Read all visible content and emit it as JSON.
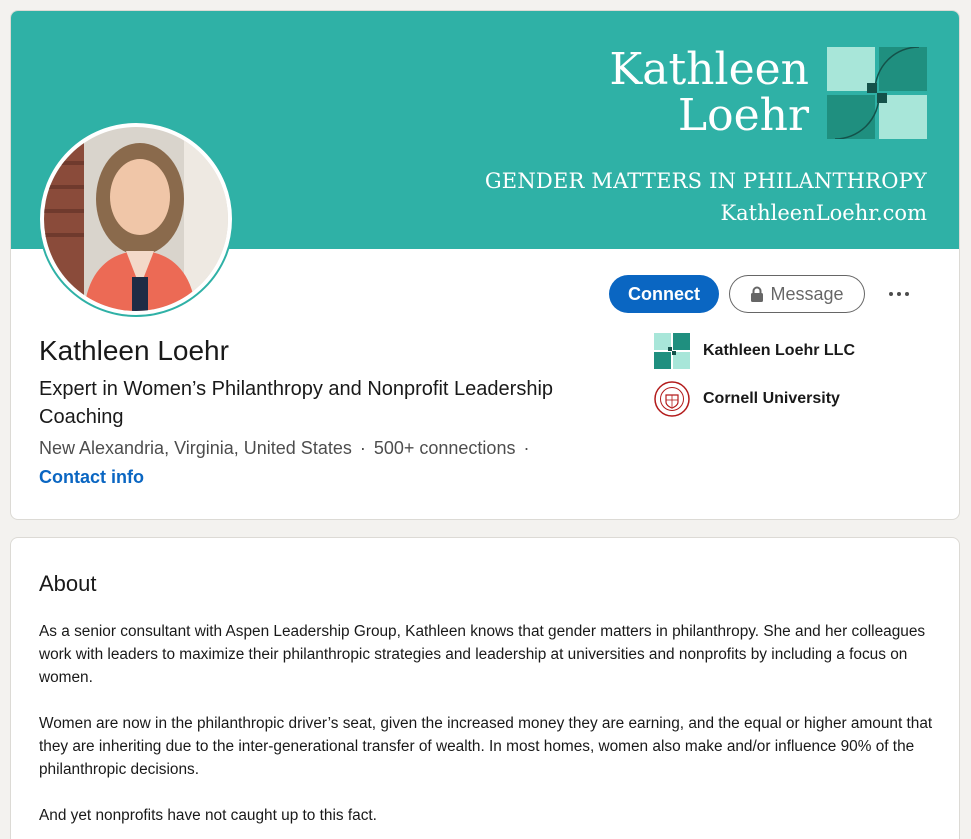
{
  "banner": {
    "name_line1": "Kathleen",
    "name_line2": "Loehr",
    "tagline": "GENDER MATTERS IN PHILANTHROPY",
    "url": "KathleenLoehr.com",
    "color": "#2fb1a6"
  },
  "profile": {
    "name": "Kathleen Loehr",
    "headline": "Expert in Women’s Philanthropy and Nonprofit Leadership Coaching",
    "location": "New Alexandria, Virginia, United States",
    "sep": "·",
    "connections": "500+ connections",
    "contact_info": "Contact info"
  },
  "actions": {
    "connect_label": "Connect",
    "message_label": "Message",
    "connect_color": "#0a66c2"
  },
  "orgs": [
    {
      "name": "Kathleen Loehr LLC",
      "icon": "company-logo-icon"
    },
    {
      "name": "Cornell University",
      "icon": "university-seal-icon"
    }
  ],
  "about": {
    "title": "About",
    "paragraphs": [
      "As a senior consultant with Aspen Leadership Group, Kathleen knows that gender matters in philanthropy. She and her colleagues work with leaders to maximize their philanthropic strategies and leadership at universities and nonprofits by including a focus on women.",
      "Women are now in the philanthropic driver’s seat, given the increased money they are earning, and the equal or higher amount that they are inheriting due to the inter-generational transfer of wealth. In most homes, women also make and/or influence 90% of the philanthropic decisions.",
      "And yet nonprofits have not caught up to this fact."
    ]
  }
}
